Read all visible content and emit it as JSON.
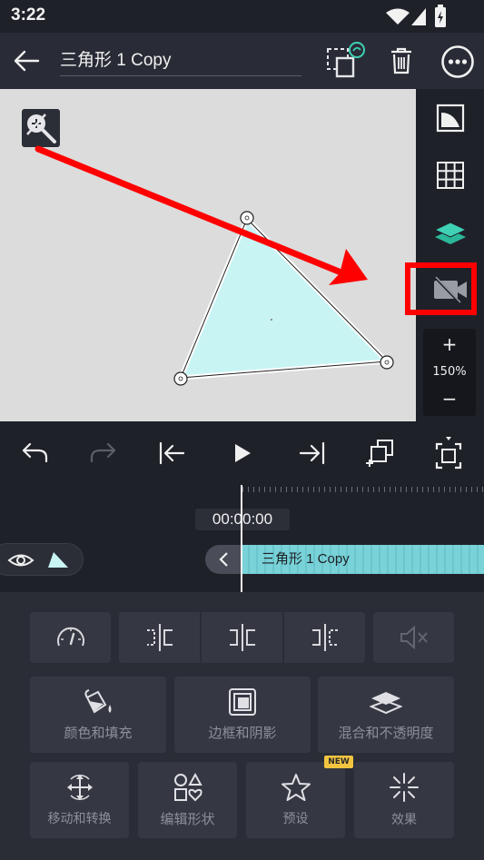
{
  "status_bar": {
    "time": "3:22"
  },
  "header": {
    "title": "三角形 1 Copy"
  },
  "zoom": {
    "plus": "+",
    "level": "150%",
    "minus": "−"
  },
  "timeline": {
    "timecode": "00:00:00",
    "clip_label": "三角形 1 Copy"
  },
  "tools": {
    "color_fill": "颜色和填充",
    "border_shadow": "边框和阴影",
    "blend_opacity": "混合和不透明度",
    "move_transform": "移动和转换",
    "edit_shape": "编辑形状",
    "preset": "预设",
    "preset_badge": "NEW",
    "effects": "效果"
  },
  "colors": {
    "accent_teal": "#3fd1b5",
    "highlight_red": "#ff0000",
    "shape_fill": "#c8f4f4",
    "clip_fill": "#78d2d8"
  }
}
